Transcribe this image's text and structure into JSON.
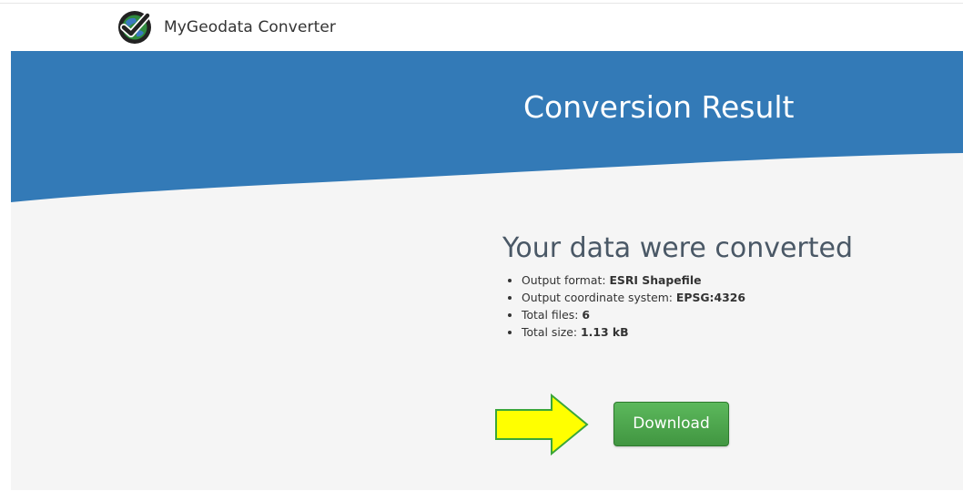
{
  "header": {
    "brand_name": "MyGeodata Converter",
    "logo_icon": "checkmark-globe-icon"
  },
  "hero": {
    "title": "Conversion Result",
    "background_color": "#337ab7"
  },
  "result": {
    "heading": "Your data were converted",
    "details": [
      {
        "label": "Output format: ",
        "value": "ESRI Shapefile"
      },
      {
        "label": "Output coordinate system: ",
        "value": "EPSG:4326"
      },
      {
        "label": "Total files: ",
        "value": "6"
      },
      {
        "label": "Total size: ",
        "value": "1.13 kB"
      }
    ]
  },
  "actions": {
    "download_label": "Download",
    "download_color": "#4cae4c",
    "arrow_icon": "right-arrow-icon",
    "arrow_color": "#ffff00"
  }
}
